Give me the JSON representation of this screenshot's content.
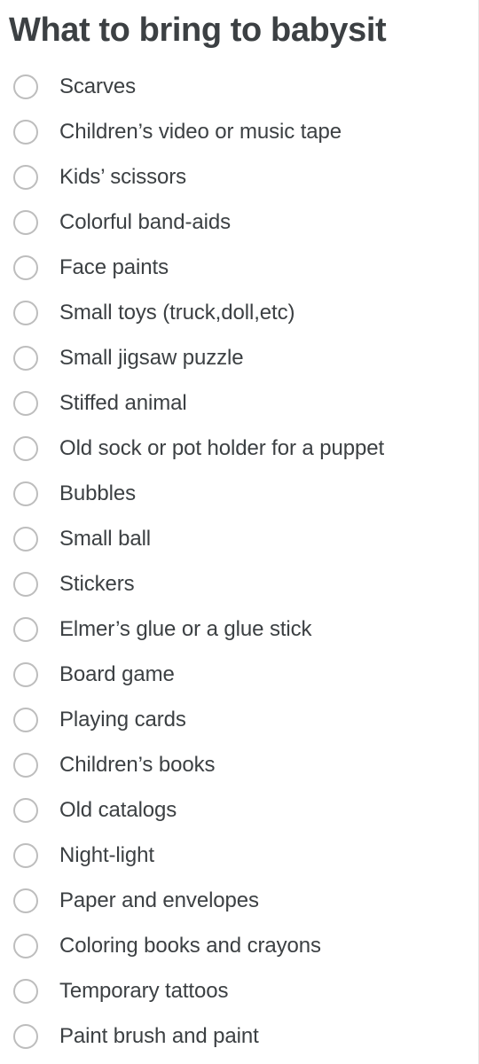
{
  "form": {
    "title": "What to bring to babysit",
    "input_type": "radio",
    "colors": {
      "text": "#3c4043",
      "radio_border": "#bdbdbd",
      "background": "#ffffff",
      "edge_border": "#e8e8e8"
    },
    "options": [
      {
        "label": "Scarves",
        "selected": false
      },
      {
        "label": "Children’s video or music tape",
        "selected": false
      },
      {
        "label": "Kids’ scissors",
        "selected": false
      },
      {
        "label": "Colorful band-aids",
        "selected": false
      },
      {
        "label": "Face paints",
        "selected": false
      },
      {
        "label": "Small toys (truck,doll,etc)",
        "selected": false
      },
      {
        "label": "Small jigsaw puzzle",
        "selected": false
      },
      {
        "label": "Stiffed animal",
        "selected": false
      },
      {
        "label": "Old sock or pot holder for a puppet",
        "selected": false
      },
      {
        "label": "Bubbles",
        "selected": false
      },
      {
        "label": "Small ball",
        "selected": false
      },
      {
        "label": "Stickers",
        "selected": false
      },
      {
        "label": "Elmer’s glue or a glue stick",
        "selected": false
      },
      {
        "label": "Board game",
        "selected": false
      },
      {
        "label": "Playing cards",
        "selected": false
      },
      {
        "label": "Children’s books",
        "selected": false
      },
      {
        "label": "Old catalogs",
        "selected": false
      },
      {
        "label": "Night-light",
        "selected": false
      },
      {
        "label": "Paper and envelopes",
        "selected": false
      },
      {
        "label": "Coloring books and crayons",
        "selected": false
      },
      {
        "label": "Temporary tattoos",
        "selected": false
      },
      {
        "label": "Paint brush and paint",
        "selected": false
      }
    ]
  }
}
